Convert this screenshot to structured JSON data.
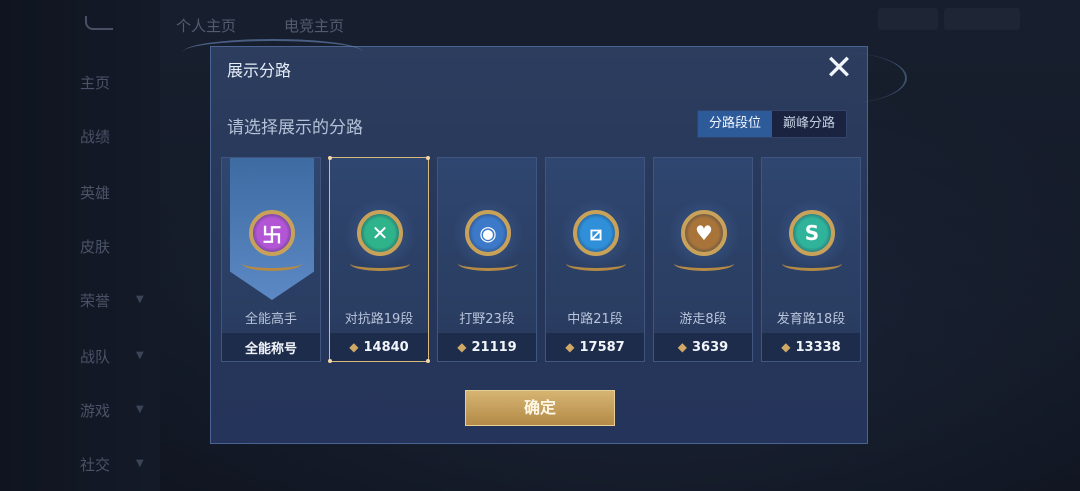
{
  "background": {
    "top_tabs": [
      "个人主页",
      "电竞主页"
    ],
    "side_items": [
      "主页",
      "战绩",
      "英雄",
      "皮肤",
      "荣誉",
      "战队",
      "游戏",
      "社交"
    ]
  },
  "dialog": {
    "title": "展示分路",
    "subtitle": "请选择展示的分路",
    "close_icon": "close-icon",
    "tabs": [
      {
        "label": "分路段位",
        "active": true
      },
      {
        "label": "巅峰分路",
        "active": false
      }
    ],
    "cards": [
      {
        "label": "全能高手",
        "footer": "全能称号",
        "icon": "allround-badge-icon",
        "symbol": "卐",
        "color": "#b356d6",
        "selected": false
      },
      {
        "label": "对抗路19段",
        "footer": "14840",
        "icon": "clash-lane-badge-icon",
        "symbol": "✕",
        "color": "#2fb38a",
        "selected": true
      },
      {
        "label": "打野23段",
        "footer": "21119",
        "icon": "jungle-badge-icon",
        "symbol": "◉",
        "color": "#3d79c9",
        "selected": false
      },
      {
        "label": "中路21段",
        "footer": "17587",
        "icon": "mid-lane-badge-icon",
        "symbol": "⧄",
        "color": "#2f8fd9",
        "selected": false
      },
      {
        "label": "游走8段",
        "footer": "3639",
        "icon": "roam-badge-icon",
        "symbol": "♥",
        "color": "#a8743a",
        "selected": false
      },
      {
        "label": "发育路18段",
        "footer": "13338",
        "icon": "farm-lane-badge-icon",
        "symbol": "S",
        "color": "#2fb39a",
        "selected": false
      }
    ],
    "confirm_label": "确定"
  }
}
